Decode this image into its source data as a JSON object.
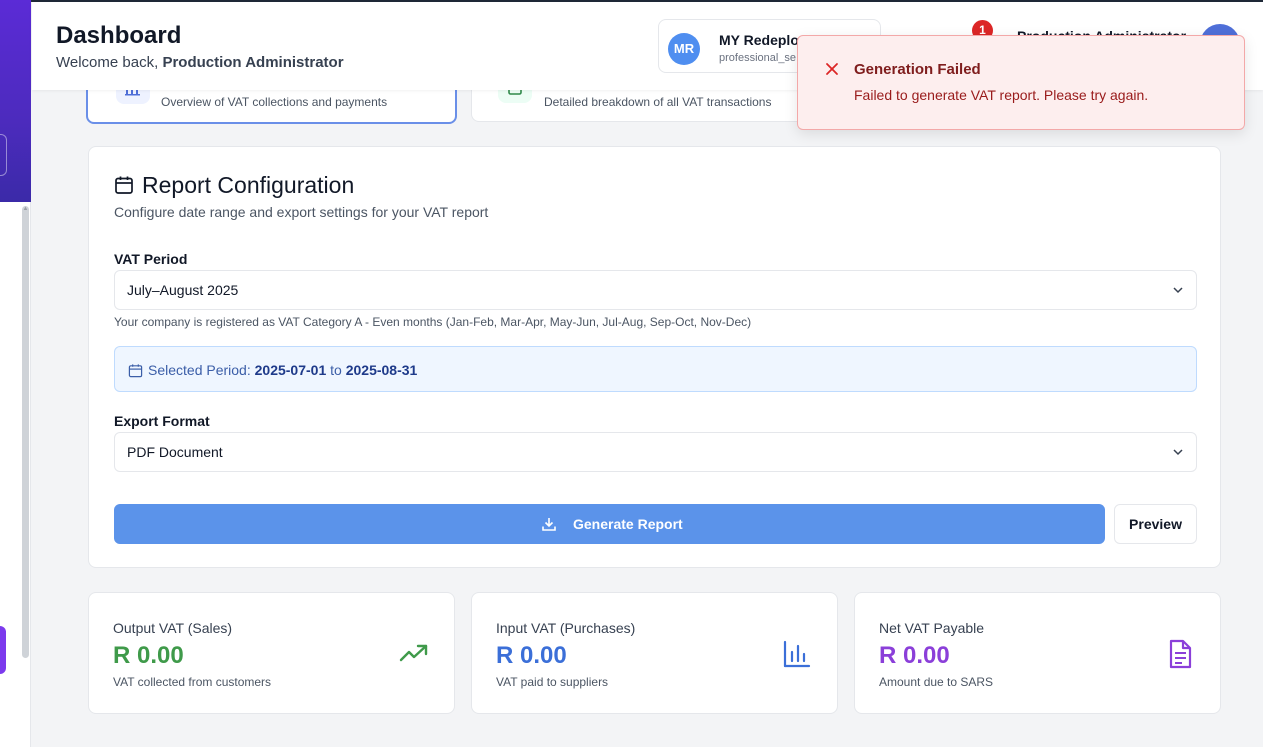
{
  "header": {
    "title": "Dashboard",
    "welcome_prefix": "Welcome back,",
    "user_full": "Production Administrator",
    "company_initials": "MR",
    "company_name": "MY Redeploy",
    "company_sub": "professional_se",
    "notification_count": "1",
    "user_name": "Production Administrator"
  },
  "tabs": [
    {
      "description": "Overview of VAT collections and payments",
      "active": true
    },
    {
      "description": "Detailed breakdown of all VAT transactions",
      "active": false
    }
  ],
  "config": {
    "title": "Report Configuration",
    "subtitle": "Configure date range and export settings for your VAT report",
    "period_label": "VAT Period",
    "period_value": "July–August 2025",
    "period_hint": "Your company is registered as VAT Category A - Even months (Jan-Feb, Mar-Apr, May-Jun, Jul-Aug, Sep-Oct, Nov-Dec)",
    "selected_prefix": "Selected Period:",
    "selected_start": "2025-07-01",
    "selected_to": "to",
    "selected_end": "2025-08-31",
    "format_label": "Export Format",
    "format_value": "PDF Document",
    "generate_label": "Generate Report",
    "preview_label": "Preview"
  },
  "stats": [
    {
      "label": "Output VAT (Sales)",
      "value": "R 0.00",
      "sub": "VAT collected from customers",
      "color": "#3f9a4a",
      "icon": "trending-up-icon"
    },
    {
      "label": "Input VAT (Purchases)",
      "value": "R 0.00",
      "sub": "VAT paid to suppliers",
      "color": "#3b6fd8",
      "icon": "bar-chart-icon"
    },
    {
      "label": "Net VAT Payable",
      "value": "R 0.00",
      "sub": "Amount due to SARS",
      "color": "#8b3fd9",
      "icon": "file-text-icon"
    }
  ],
  "toast": {
    "title": "Generation Failed",
    "message": "Failed to generate VAT report. Please try again."
  },
  "colors": {
    "accent": "#5b93ea",
    "sidebar": "#4c2bbd",
    "error": "#dc2626"
  }
}
